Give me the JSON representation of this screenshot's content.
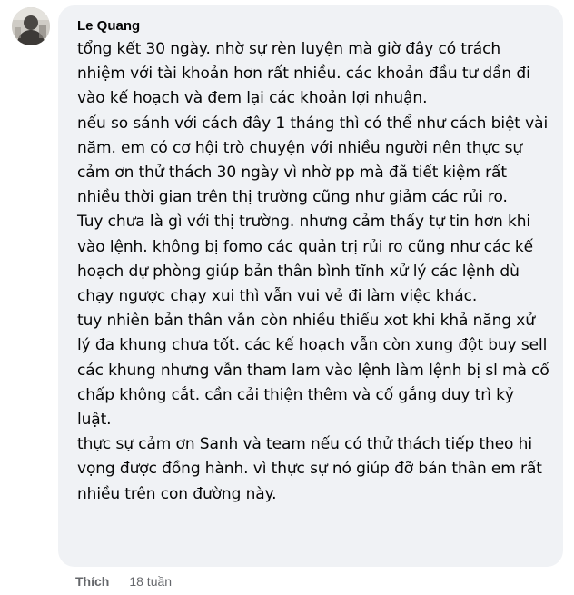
{
  "comment": {
    "author": "Le Quang",
    "paragraphs": [
      "tổng kết 30 ngày. nhờ sự rèn luyện mà giờ đây có trách nhiệm với tài khoản hơn rất nhiều. các khoản đầu tư dần đi vào kế hoạch và đem lại các khoản lợi nhuận.",
      "nếu so sánh với cách đây 1 tháng thì có thể như cách biệt vài năm. em có cơ hội trò chuyện với nhiều người nên thực sự cảm ơn thử thách 30 ngày vì nhờ pp mà đã tiết kiệm rất nhiều thời gian trên thị trường cũng như giảm các rủi ro.",
      "Tuy chưa là gì với thị trường. nhưng cảm thấy tự tin hơn khi vào lệnh. không bị fomo các quản trị rủi ro cũng như các kế hoạch dự phòng giúp bản thân bình tĩnh xử lý các lệnh dù chạy ngược chạy xui thì vẫn vui vẻ đi làm việc khác.",
      "tuy nhiên bản thân vẫn còn nhiều thiếu xot khi khả năng xử lý đa khung chưa tốt. các kế hoạch vẫn còn xung đột buy sell các khung nhưng vẫn tham lam vào lệnh làm lệnh bị sl mà cố chấp không cắt. cần cải thiện thêm và cố gắng duy trì kỷ luật.",
      "thực sự cảm ơn Sanh và team nếu có thử thách tiếp theo hi vọng được đồng hành. vì thực sự nó giúp đỡ bản thân em rất nhiều trên con đường này."
    ]
  },
  "actions": {
    "like_label": "Thích",
    "timestamp": "18 tuần"
  },
  "avatar": {
    "icon": "avatar-photo"
  },
  "colors": {
    "bubble_background": "#f0f2f5",
    "text": "#050505",
    "secondary_text": "#65676b"
  }
}
